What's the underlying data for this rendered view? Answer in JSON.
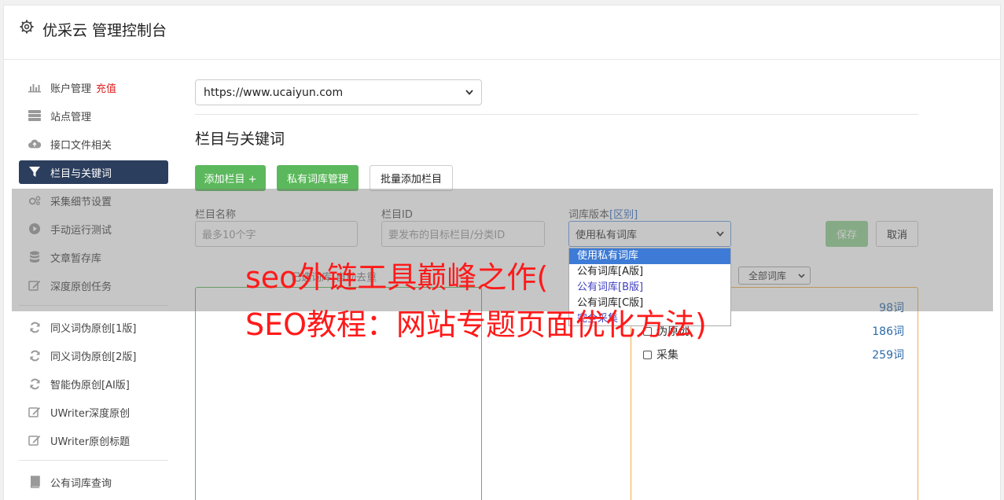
{
  "app": {
    "title": "优采云 管理控制台",
    "icon": "gear-icon"
  },
  "sidebar": {
    "items": [
      {
        "label": "账户管理",
        "badge": "充值",
        "icon": "bar-chart-icon"
      },
      {
        "label": "站点管理",
        "icon": "server-icon"
      },
      {
        "label": "接口文件相关",
        "icon": "cloud-upload-icon"
      },
      {
        "label": "栏目与关键词",
        "icon": "filter-icon",
        "active": true
      },
      {
        "label": "采集细节设置",
        "icon": "cogs-icon"
      },
      {
        "label": "手动运行测试",
        "icon": "play-circle-icon"
      },
      {
        "label": "文章暂存库",
        "icon": "database-icon"
      },
      {
        "label": "深度原创任务",
        "icon": "edit-icon"
      }
    ],
    "items2": [
      {
        "label": "同义词伪原创[1版]",
        "icon": "refresh-icon"
      },
      {
        "label": "同义词伪原创[2版]",
        "icon": "refresh-icon"
      },
      {
        "label": "智能伪原创[AI版]",
        "icon": "refresh-icon"
      },
      {
        "label": "UWriter深度原创",
        "icon": "edit-icon"
      },
      {
        "label": "UWriter原创标题",
        "icon": "edit-icon"
      }
    ],
    "items3": [
      {
        "label": "公有词库查询",
        "icon": "book-icon"
      }
    ]
  },
  "site_select": {
    "value": "https://www.ucaiyun.com"
  },
  "section": {
    "title": "栏目与关键词"
  },
  "buttons": {
    "add_column": "添加栏目 +",
    "private_lib": "私有词库管理",
    "batch_add": "批量添加栏目",
    "save": "保存",
    "cancel": "取消"
  },
  "form": {
    "name_label": "栏目名称",
    "name_placeholder": "最多10个字",
    "id_label": "栏目ID",
    "id_placeholder": "要发布的目标栏目/分类ID",
    "lib_label": "词库版本",
    "lib_label_link": "[区别]",
    "lib_value": "使用私有词库"
  },
  "dropdown": {
    "options": [
      "使用私有词库",
      "公有词库[A版]",
      "公有词库[B版]",
      "公有词库[C版]",
      "完全采集"
    ]
  },
  "filter": {
    "value": "全部词库"
  },
  "panel": {
    "caption": "已选词库(自动去重"
  },
  "libraries": [
    {
      "name": "",
      "count": "98词"
    },
    {
      "name": "伪原创",
      "count": "186词"
    },
    {
      "name": "采集",
      "count": "259词"
    }
  ],
  "overlay": {
    "line1": "seo外链工具巅峰之作(",
    "line2": "SEO教程：网站专题页面优化方法)"
  }
}
